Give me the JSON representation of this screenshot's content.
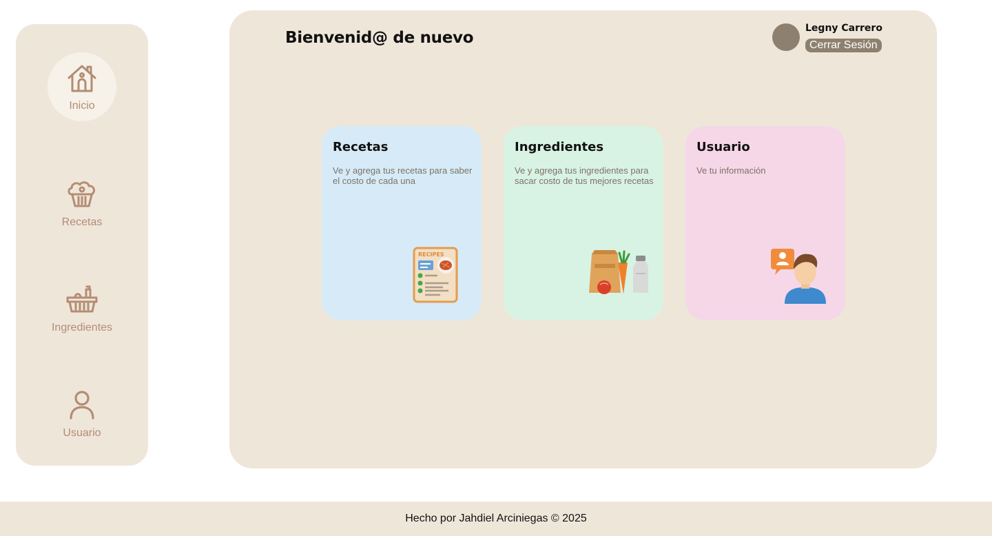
{
  "sidebar": {
    "items": [
      {
        "label": "Inicio",
        "icon": "home-icon",
        "active": true
      },
      {
        "label": "Recetas",
        "icon": "muffin-icon",
        "active": false
      },
      {
        "label": "Ingredientes",
        "icon": "basket-icon",
        "active": false
      },
      {
        "label": "Usuario",
        "icon": "user-icon",
        "active": false
      }
    ]
  },
  "header": {
    "welcome": "Bienvenid@ de nuevo",
    "user_name": "Legny Carrero",
    "logout_label": "Cerrar Sesión"
  },
  "cards": [
    {
      "title": "Recetas",
      "description": "Ve y agrega tus recetas para saber el costo de cada una",
      "illustration": "recipes-document-icon",
      "color": "#d6ebf7",
      "illustration_text": "RECIPES"
    },
    {
      "title": "Ingredientes",
      "description": "Ve y agrega tus ingredientes para sacar costo de tus mejores recetas",
      "illustration": "groceries-icon",
      "color": "#d8f3e3"
    },
    {
      "title": "Usuario",
      "description": "Ve tu información",
      "illustration": "user-profile-icon",
      "color": "#f6d7e7"
    }
  ],
  "footer": {
    "text": "Hecho por Jahdiel Arciniegas © 2025"
  },
  "colors": {
    "panel": "#efe6da",
    "icon": "#b38c73",
    "avatar": "#8e806f",
    "active_nav": "#f6f2e9"
  }
}
